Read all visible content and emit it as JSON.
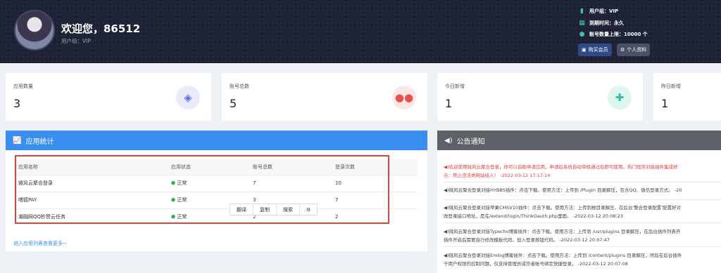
{
  "header": {
    "welcome": "欢迎您，86512",
    "user_group": "用户组：VIP",
    "info": [
      {
        "icon": "user-group-icon",
        "label": "用户组：VIP"
      },
      {
        "icon": "calendar-icon",
        "label": "到期时间：永久"
      },
      {
        "icon": "account-limit-icon",
        "label": "账号数量上限：10000 个"
      }
    ],
    "buy_label": "购买会员",
    "profile_label": "个人资料"
  },
  "stats": [
    {
      "label": "应用数量",
      "value": "3",
      "icon": "apps-icon",
      "color": "#5a6fd8",
      "bg": "#e7ebfb"
    },
    {
      "label": "账号总数",
      "value": "5",
      "icon": "users-icon",
      "color": "#e5534b",
      "bg": "#fbe7e6"
    },
    {
      "label": "今日新增",
      "value": "1",
      "icon": "calendar-plus-icon",
      "color": "#2fb9a8",
      "bg": "#dff5f2"
    },
    {
      "label": "昨日新增",
      "value": "1",
      "icon": "",
      "color": "",
      "bg": ""
    }
  ],
  "app_panel": {
    "title": "应用统计",
    "columns": [
      "应用名称",
      "应用状态",
      "账号总数",
      "登录次数"
    ],
    "rows": [
      [
        "微风云聚合登录",
        "正常",
        "7",
        "10"
      ],
      [
        "喂狐PAY",
        "正常",
        "3",
        "7"
      ],
      [
        "潮融网QQ秒赞云任务",
        "正常",
        "2",
        "2"
      ]
    ],
    "more_link": "进入应用列表查看更多››"
  },
  "context_menu": [
    "翻译",
    "复制",
    "搜索"
  ],
  "notice_panel": {
    "title": "公告通知",
    "notices": [
      {
        "lines": [
          "◀)欢迎使用微风云聚合登录，你可以自助申请应用，申请后系统自动审核通过后即可使用。热门程序对接插件集成好",
          "示：禁止违法类网站接入！ -2022-03-12 17:17:14"
        ],
        "red": true
      },
      {
        "lines": [
          "◀)微风云聚合登录对接HYBBS插件：点击下载。使用方法：上传到 /Plugin 目录解压，包含QQ、微信登录方式。 -20"
        ],
        "red": false
      },
      {
        "lines": [
          "◀)微风云聚合登录对接苹果CMSV10插件：点击下载。使用方法：上传到根目录解压，在后台'整合登录配置'配置好对",
          "改登录接口地址，是在/extend/login/ThinkOauth.php里面。 -2022-03-12 20:08:23"
        ],
        "red": false
      },
      {
        "lines": [
          "◀)微风云聚合登录对接Typecho博客插件：点击下载。使用方法：上传到 /usr/plugins 目录解压，在后台插件列表开",
          "插件开启后需要自行修改模板代码，加入登录按钮代码。 -2022-03-12 20:07:47"
        ],
        "red": false
      },
      {
        "lines": [
          "◀)微风云聚合登录对接Emlog博客插件：点击下载。使用方法：上传到 /content/plugins 目录解压，然后在后台插件",
          "于用户权限的控制问题，仅支持管理员或作者账号绑定快捷登录。 -2022-03-12 20:07:08"
        ],
        "red": false
      }
    ]
  }
}
